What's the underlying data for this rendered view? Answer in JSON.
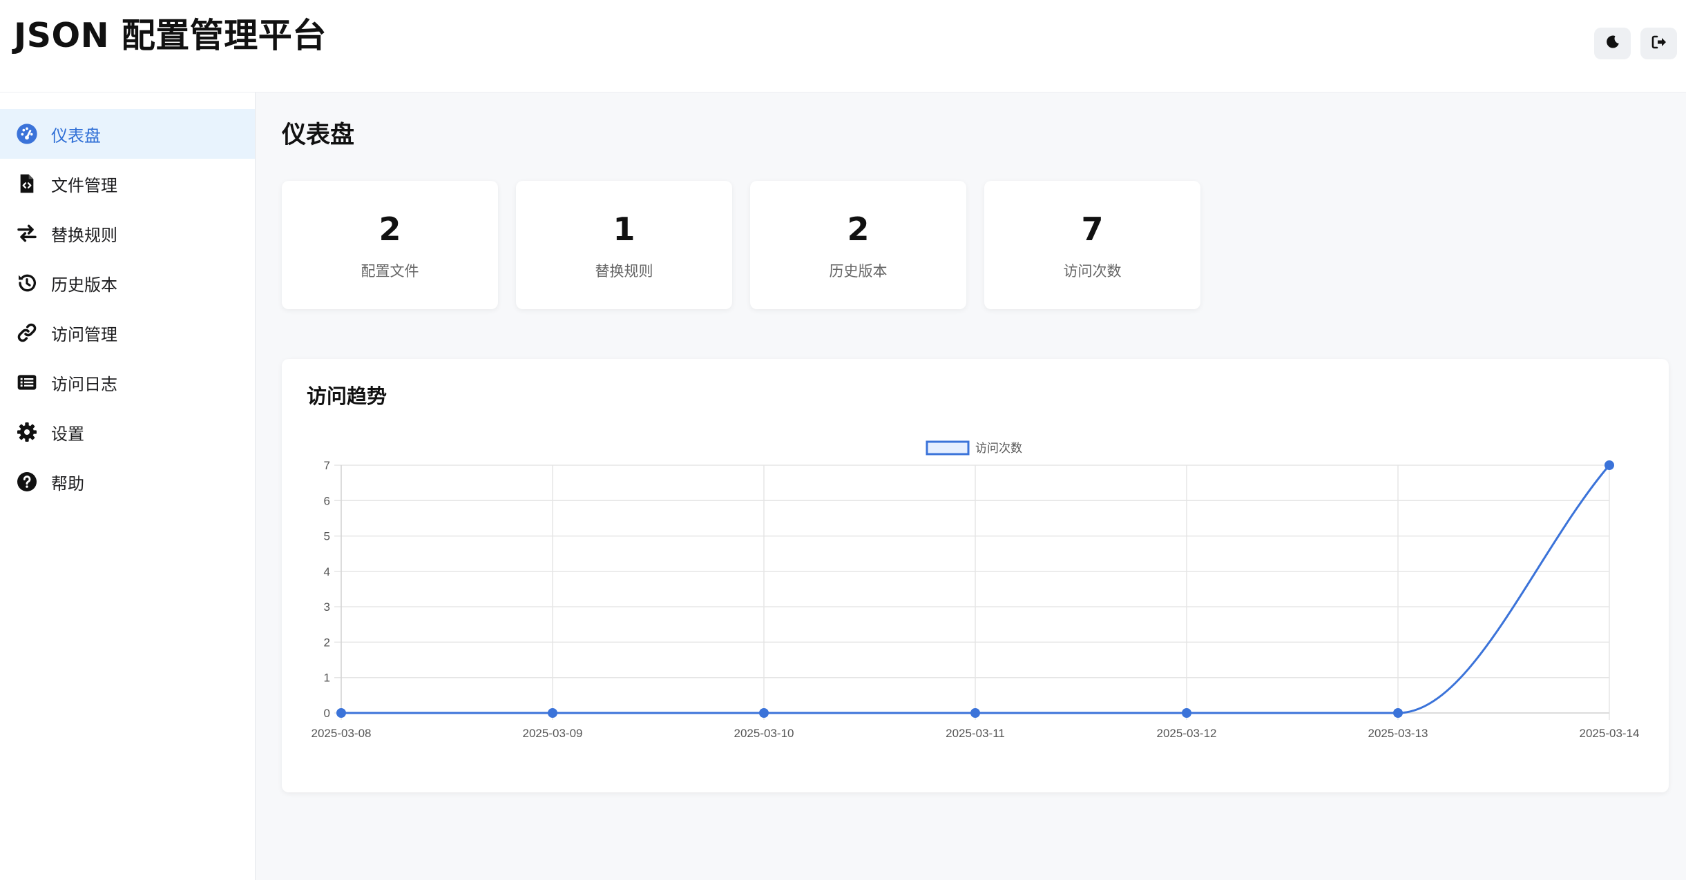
{
  "app": {
    "title": "JSON 配置管理平台"
  },
  "header": {
    "buttons": [
      {
        "icon": "moon-icon"
      },
      {
        "icon": "logout-icon"
      }
    ]
  },
  "sidebar": {
    "items": [
      {
        "label": "仪表盘",
        "icon": "dashboard-gauge-icon",
        "active": true
      },
      {
        "label": "文件管理",
        "icon": "file-code-icon"
      },
      {
        "label": "替换规则",
        "icon": "swap-arrows-icon"
      },
      {
        "label": "历史版本",
        "icon": "history-icon"
      },
      {
        "label": "访问管理",
        "icon": "link-icon"
      },
      {
        "label": "访问日志",
        "icon": "list-icon"
      },
      {
        "label": "设置",
        "icon": "gear-icon"
      },
      {
        "label": "帮助",
        "icon": "question-circle-icon"
      }
    ]
  },
  "main": {
    "title": "仪表盘",
    "stats": [
      {
        "value": "2",
        "label": "配置文件"
      },
      {
        "value": "1",
        "label": "替换规则"
      },
      {
        "value": "2",
        "label": "历史版本"
      },
      {
        "value": "7",
        "label": "访问次数"
      }
    ],
    "chart_card_title": "访问趋势"
  },
  "colors": {
    "accent": "#3b73d9",
    "active_bg": "#e8f3fd",
    "grid": "#e5e5e5"
  },
  "chart_data": {
    "type": "line",
    "title": "访问趋势",
    "categories": [
      "2025-03-08",
      "2025-03-09",
      "2025-03-10",
      "2025-03-11",
      "2025-03-12",
      "2025-03-13",
      "2025-03-14"
    ],
    "series": [
      {
        "name": "访问次数",
        "values": [
          0,
          0,
          0,
          0,
          0,
          0,
          7
        ]
      }
    ],
    "ylim": [
      0,
      7
    ],
    "yticks": [
      0,
      1,
      2,
      3,
      4,
      5,
      6,
      7
    ],
    "grid": true,
    "legend": "top-center"
  }
}
